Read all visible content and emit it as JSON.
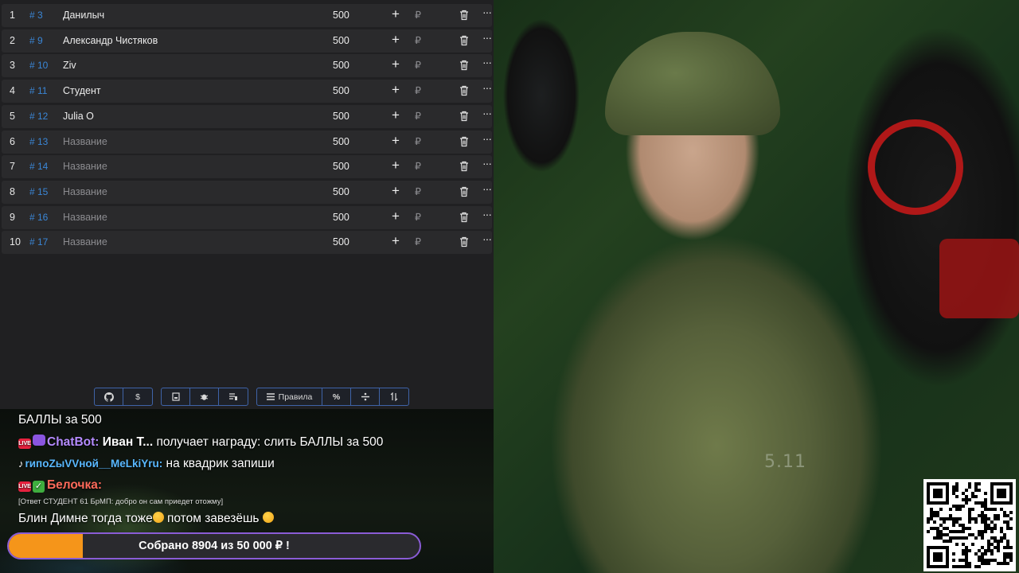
{
  "table": {
    "rows": [
      {
        "num": "1",
        "id": "# 3",
        "name": "Данилыч",
        "placeholder": false,
        "value": "500"
      },
      {
        "num": "2",
        "id": "# 9",
        "name": "Александр Чистяков",
        "placeholder": false,
        "value": "500"
      },
      {
        "num": "3",
        "id": "# 10",
        "name": "Ziv",
        "placeholder": false,
        "value": "500"
      },
      {
        "num": "4",
        "id": "# 11",
        "name": "Студент",
        "placeholder": false,
        "value": "500"
      },
      {
        "num": "5",
        "id": "# 12",
        "name": "Julia O",
        "placeholder": false,
        "value": "500"
      },
      {
        "num": "6",
        "id": "# 13",
        "name": "Название",
        "placeholder": true,
        "value": "500"
      },
      {
        "num": "7",
        "id": "# 14",
        "name": "Название",
        "placeholder": true,
        "value": "500"
      },
      {
        "num": "8",
        "id": "# 15",
        "name": "Название",
        "placeholder": true,
        "value": "500"
      },
      {
        "num": "9",
        "id": "# 16",
        "name": "Название",
        "placeholder": true,
        "value": "500"
      },
      {
        "num": "10",
        "id": "# 17",
        "name": "Название",
        "placeholder": true,
        "value": "500"
      }
    ],
    "add_symbol": "+",
    "currency_symbol": "₽",
    "more_symbol": "···"
  },
  "toolbar": {
    "github_icon": "github-icon",
    "dollar": "$",
    "save_icon": "save-icon",
    "bug_icon": "bug-icon",
    "clear_icon": "clear-list-icon",
    "rules_label": "Правила",
    "percent": "%",
    "divide_icon": "divide-icon",
    "sort_icon": "sort-icon"
  },
  "chat": {
    "messages": [
      {
        "text": "БАЛЛЫ за 500"
      },
      {
        "author": "ChatBot:",
        "bold": "Иван Т...",
        "text": " получает награду: слить БАЛЛЫ за 500"
      },
      {
        "author": "rипоZыVVной__MeLkiYru:",
        "text": " на квадрик запиши"
      },
      {
        "author": "Белочка:",
        "reply": "[Ответ СТУДЕНТ 61 БрМП: добро он сам приедет отожму]",
        "text": "Блин Димне тогда тоже",
        "text2": " потом завезёшь"
      }
    ]
  },
  "goal": {
    "label": "Собрано 8904  из 50 000 ₽ !",
    "progress": 0.18,
    "fill_color": "#f5951a",
    "border_color": "#8a5cd6"
  },
  "overlay": {
    "qr_icon": "qr-code-icon",
    "shirt_brand": "5.11"
  }
}
